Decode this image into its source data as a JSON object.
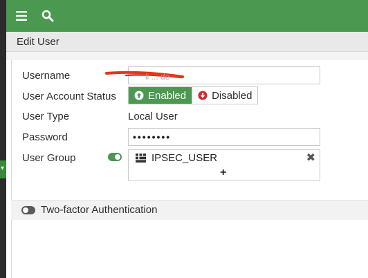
{
  "topbar": {
    "menu_icon": "hamburger-menu-icon",
    "search_icon": "search-icon",
    "color": "#4b9850"
  },
  "page": {
    "title": "Edit User"
  },
  "form": {
    "username": {
      "label": "Username",
      "value": ""
    },
    "status": {
      "label": "User Account Status",
      "enabled_label": "Enabled",
      "disabled_label": "Disabled",
      "selected": "Enabled"
    },
    "user_type": {
      "label": "User Type",
      "value": "Local User"
    },
    "password": {
      "label": "Password",
      "value": "••••••••"
    },
    "user_group": {
      "label": "User Group",
      "toggle": "on",
      "groups": [
        "IPSEC_USER"
      ],
      "add_label": "+"
    },
    "two_factor": {
      "label": "Two-factor Authentication",
      "toggle": "off"
    }
  }
}
